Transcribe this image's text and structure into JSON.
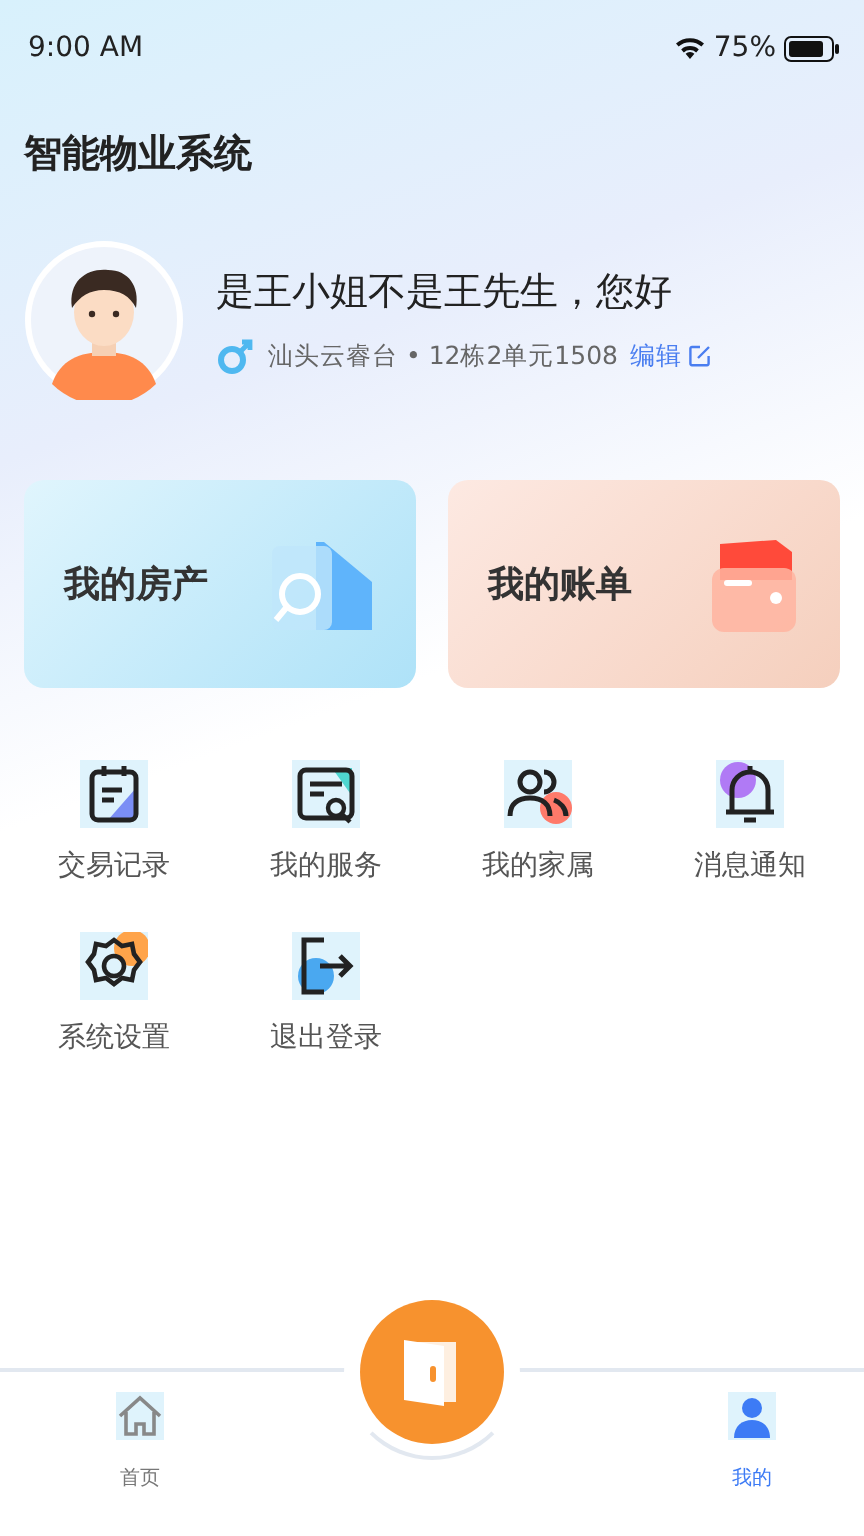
{
  "status_bar": {
    "time": "9:00 AM",
    "battery": "75%"
  },
  "app_title": "智能物业系统",
  "profile": {
    "greeting": "是王小姐不是王先生，您好",
    "address": "汕头云睿台 • 12栋2单元1508",
    "edit_link": "编辑"
  },
  "cards": [
    {
      "label": "我的房产",
      "kind": "property"
    },
    {
      "label": "我的账单",
      "kind": "bill"
    }
  ],
  "menu": [
    {
      "label": "交易记录"
    },
    {
      "label": "我的服务"
    },
    {
      "label": "我的家属"
    },
    {
      "label": "消息通知"
    },
    {
      "label": "系统设置"
    },
    {
      "label": "退出登录"
    }
  ],
  "tab_bar": [
    {
      "label": "首页",
      "selected": false
    },
    {
      "label": "我的",
      "selected": true
    }
  ]
}
